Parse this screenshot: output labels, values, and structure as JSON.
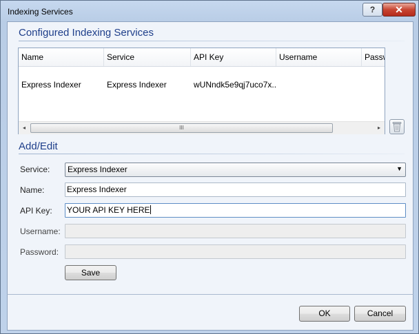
{
  "window": {
    "title": "Indexing Services"
  },
  "titlebar": {
    "help_glyph": "?",
    "close_glyph": "✕"
  },
  "configured": {
    "header": "Configured Indexing Services",
    "columns": [
      "Name",
      "Service",
      "API Key",
      "Username",
      "Passw"
    ],
    "rows": [
      {
        "name": "Express Indexer",
        "service": "Express Indexer",
        "api_key": "wUNndk5e9qj7uco7x...",
        "username": "",
        "password": ""
      }
    ],
    "scroll": {
      "left": "◂",
      "right": "▸",
      "grip": "III"
    },
    "delete_icon": "trash-icon"
  },
  "add_edit": {
    "header": "Add/Edit",
    "service_label": "Service:",
    "service_value": "Express Indexer",
    "name_label": "Name:",
    "name_value": "Express Indexer",
    "apikey_label": "API Key:",
    "apikey_value": "YOUR API KEY HERE",
    "username_label": "Username:",
    "username_value": "",
    "password_label": "Password:",
    "password_value": "",
    "save_label": "Save",
    "dropdown_arrow": "▼"
  },
  "footer": {
    "ok_label": "OK",
    "cancel_label": "Cancel"
  },
  "colors": {
    "header_text": "#1e3e8a",
    "close_button": "#c84532",
    "client_bg": "#f0f4fa"
  }
}
